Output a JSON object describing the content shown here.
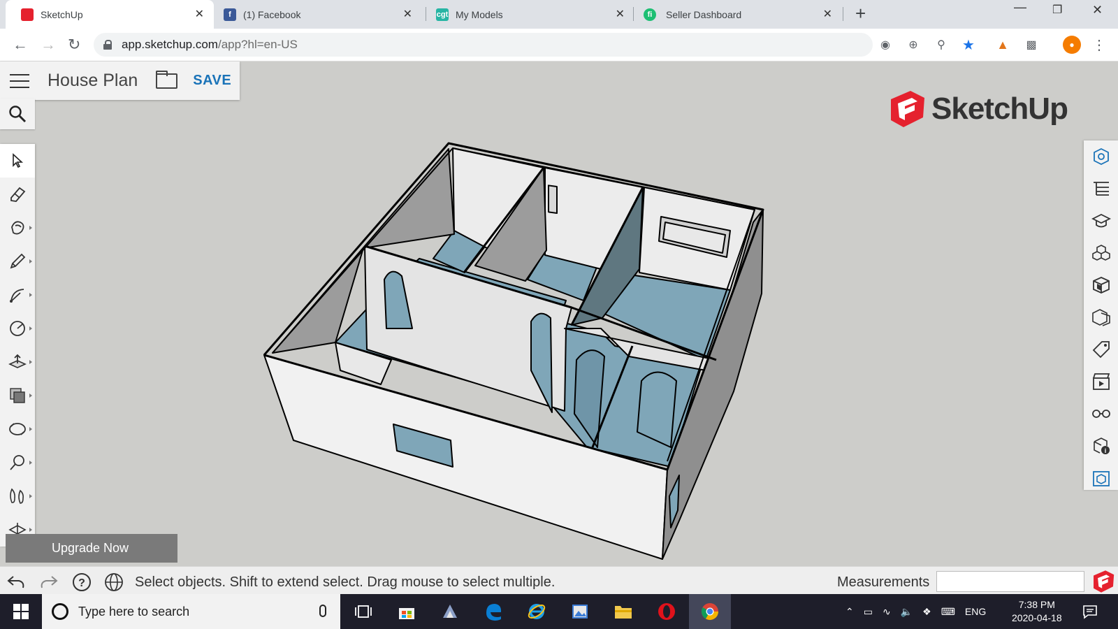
{
  "browser": {
    "tabs": [
      {
        "title": "SketchUp",
        "active": true
      },
      {
        "title": "(1) Facebook",
        "active": false
      },
      {
        "title": "My Models",
        "active": false
      },
      {
        "title": "Seller Dashboard",
        "active": false
      }
    ],
    "url_host": "app.sketchup.com",
    "url_path": "/app?hl=en-US",
    "new_tab": "+",
    "close_glyph": "✕"
  },
  "app": {
    "model_title": "House Plan",
    "save_label": "SAVE",
    "brand": "SketchUp",
    "brand_color": "#e5212e",
    "accent": "#1a73b8",
    "upgrade_label": "Upgrade Now"
  },
  "left_tools": [
    "select-icon",
    "eraser-icon",
    "paint-bucket-icon",
    "pencil-line-icon",
    "arc-icon",
    "circle-icon",
    "push-pull-icon",
    "offset-icon",
    "orbit-icon",
    "tape-measure-icon",
    "walk-icon",
    "section-plane-icon"
  ],
  "right_tools": [
    "entity-info-icon",
    "outliner-icon",
    "instructor-icon",
    "components-icon",
    "materials-icon",
    "styles-icon",
    "tags-icon",
    "scenes-icon",
    "display-icon",
    "model-info-icon",
    "solid-tools-icon"
  ],
  "status": {
    "hint": "Select objects. Shift to extend select. Drag mouse to select multiple.",
    "measurements_label": "Measurements",
    "measurements_value": ""
  },
  "taskbar": {
    "search_placeholder": "Type here to search",
    "language": "ENG",
    "time": "7:38 PM",
    "date": "2020-04-18"
  }
}
